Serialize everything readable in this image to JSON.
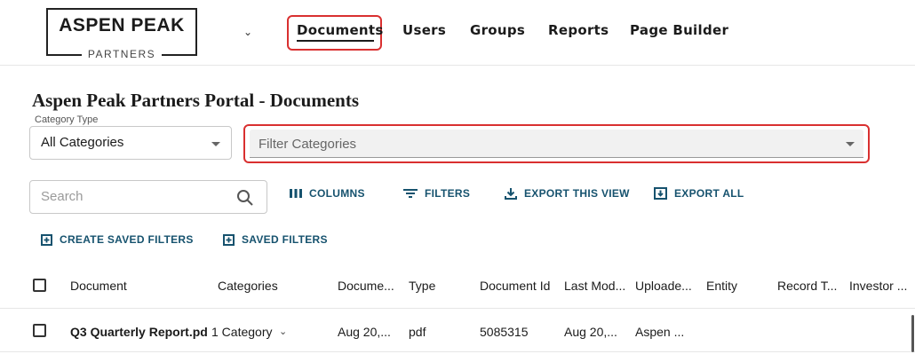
{
  "logo": {
    "main": "ASPEN PEAK",
    "sub": "PARTNERS"
  },
  "nav": {
    "items": [
      {
        "label": "Documents"
      },
      {
        "label": "Users"
      },
      {
        "label": "Groups"
      },
      {
        "label": "Reports"
      },
      {
        "label": "Page Builder"
      }
    ]
  },
  "page": {
    "title": "Aspen Peak Partners Portal - Documents"
  },
  "category": {
    "legend": "Category Type",
    "value": "All Categories"
  },
  "filter": {
    "placeholder": "Filter Categories"
  },
  "search": {
    "placeholder": "Search"
  },
  "toolbar": {
    "columns": "COLUMNS",
    "filters": "FILTERS",
    "export_view": "EXPORT THIS VIEW",
    "export_all": "EXPORT ALL",
    "create_saved_filters": "CREATE SAVED FILTERS",
    "saved_filters": "SAVED FILTERS"
  },
  "table": {
    "headers": [
      "Document",
      "Categories",
      "Docume...",
      "Type",
      "Document Id",
      "Last Mod...",
      "Uploade...",
      "Entity",
      "Record T...",
      "Investor ..."
    ],
    "rows": [
      {
        "document": "Q3 Quarterly Report.pd",
        "categories": "1 Category",
        "date": "Aug 20,...",
        "type": "pdf",
        "id": "5085315",
        "last_modified": "Aug 20,...",
        "uploaded_by": "Aspen ..."
      }
    ]
  },
  "colors": {
    "accent": "#16526e",
    "highlight": "#d93030"
  },
  "icons": [
    "chevron-down-icon",
    "search-icon",
    "columns-icon",
    "filter-icon",
    "export-icon",
    "export-all-icon",
    "saved-filter-icon",
    "dropdown-caret-icon"
  ]
}
